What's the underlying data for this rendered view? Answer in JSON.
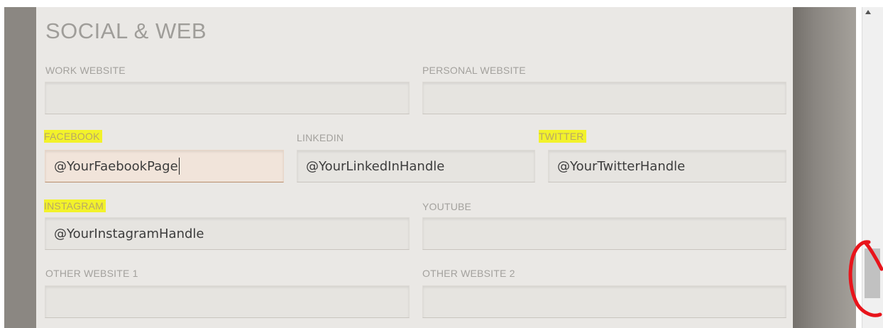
{
  "section": {
    "title": "SOCIAL & WEB"
  },
  "fields": {
    "work_website": {
      "label": "WORK WEBSITE",
      "value": ""
    },
    "personal_website": {
      "label": "PERSONAL WEBSITE",
      "value": ""
    },
    "facebook": {
      "label": "FACEBOOK",
      "value": "@YourFaebookPage",
      "highlighted": true,
      "focused": true
    },
    "linkedin": {
      "label": "LINKEDIN",
      "value": "@YourLinkedInHandle"
    },
    "twitter": {
      "label": "TWITTER",
      "value": "@YourTwitterHandle",
      "highlighted": true
    },
    "instagram": {
      "label": "INSTAGRAM",
      "value": "@YourInstagramHandle",
      "highlighted": true
    },
    "youtube": {
      "label": "YOUTUBE",
      "value": ""
    },
    "other_website_1": {
      "label": "OTHER WEBSITE 1",
      "value": ""
    },
    "other_website_2": {
      "label": "OTHER WEBSITE 2",
      "value": ""
    }
  },
  "colors": {
    "highlight": "#f2f22a",
    "panel": "#eae8e5",
    "overlay": "#8b8782",
    "annotation": "#e8141b"
  },
  "icons": {
    "scroll_up": "triangle-up-icon",
    "annotation": "red-circle-annotation"
  }
}
